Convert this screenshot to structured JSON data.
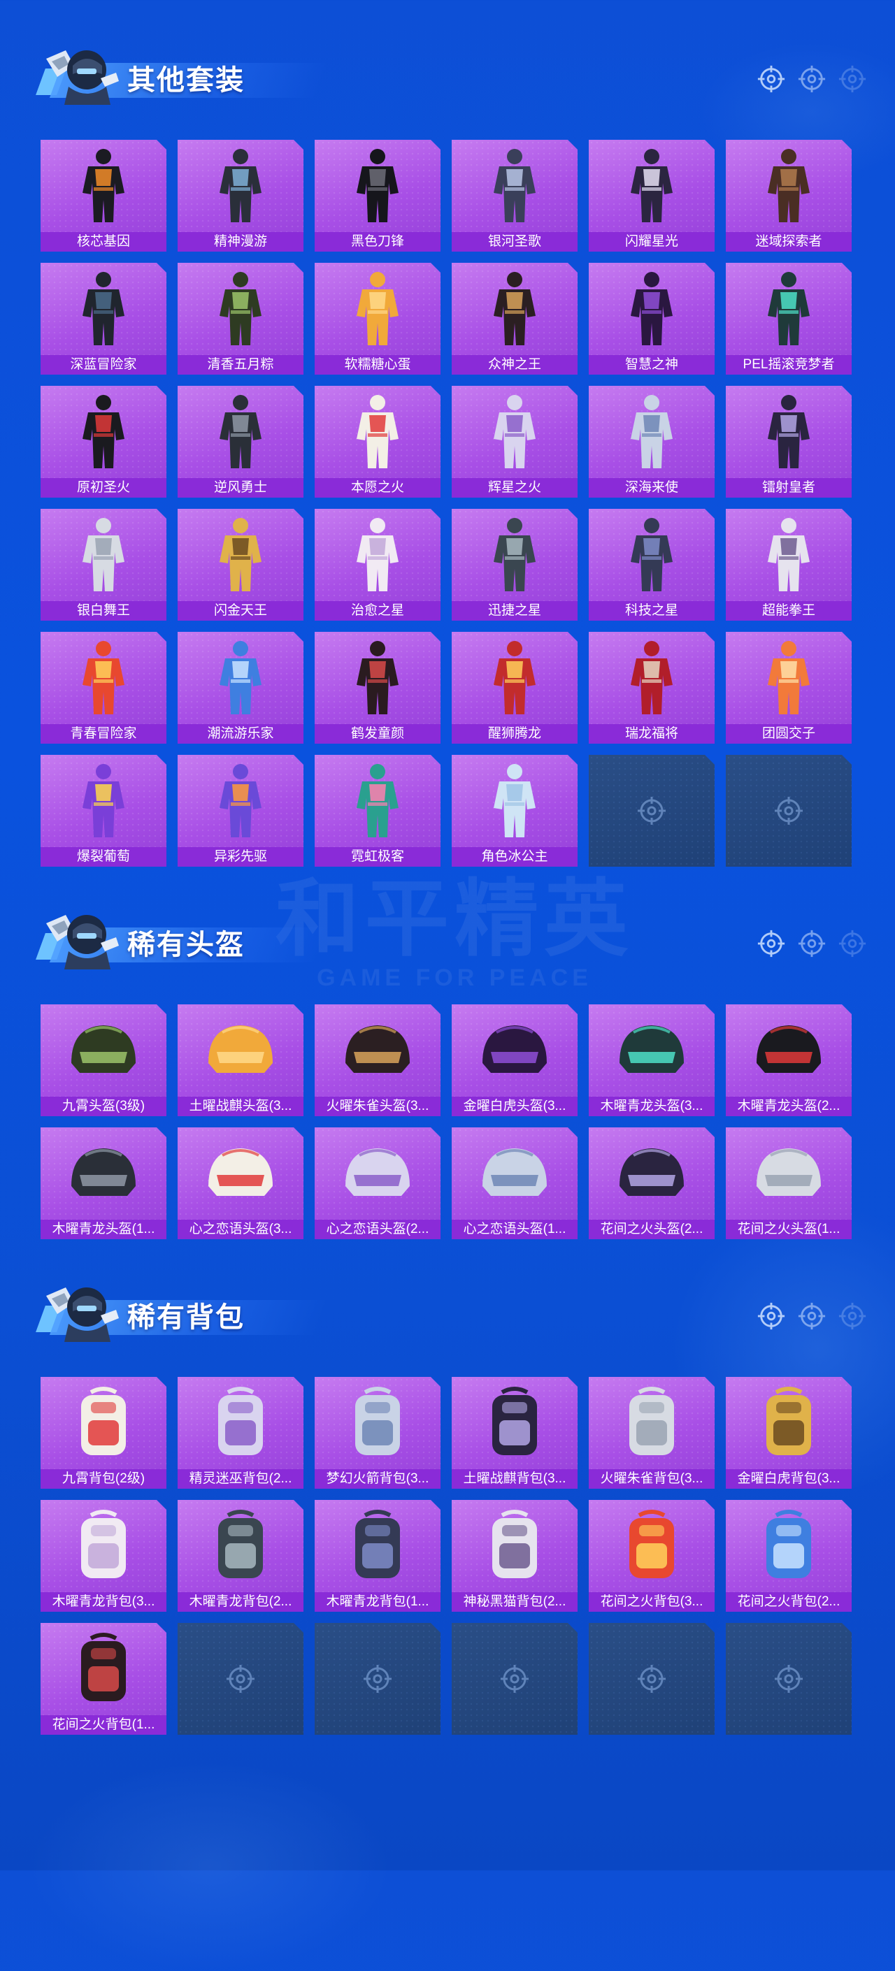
{
  "sections": [
    {
      "title": "其他套装",
      "kind": "suit",
      "items": [
        "核芯基因",
        "精神漫游",
        "黑色刀锋",
        "银河圣歌",
        "闪耀星光",
        "迷域探索者",
        "深蓝冒险家",
        "清香五月粽",
        "软糯糖心蛋",
        "众神之王",
        "智慧之神",
        "PEL摇滚竞梦者",
        "原初圣火",
        "逆风勇士",
        "本愿之火",
        "辉星之火",
        "深海来使",
        "镭射皇者",
        "银白舞王",
        "闪金天王",
        "治愈之星",
        "迅捷之星",
        "科技之星",
        "超能拳王",
        "青春冒险家",
        "潮流游乐家",
        "鹤发童颜",
        "醒狮腾龙",
        "瑞龙福将",
        "团圆交子",
        "爆裂葡萄",
        "异彩先驱",
        "霓虹极客",
        "角色冰公主"
      ],
      "empty_slots": 2
    },
    {
      "title": "稀有头盔",
      "kind": "helmet",
      "items": [
        "九霄头盔(3级)",
        "土曜战麒头盔(3...",
        "火曜朱雀头盔(3...",
        "金曜白虎头盔(3...",
        "木曜青龙头盔(3...",
        "木曜青龙头盔(2...",
        "木曜青龙头盔(1...",
        "心之恋语头盔(3...",
        "心之恋语头盔(2...",
        "心之恋语头盔(1...",
        "花间之火头盔(2...",
        "花间之火头盔(1..."
      ],
      "empty_slots": 0
    },
    {
      "title": "稀有背包",
      "kind": "backpack",
      "items": [
        "九霄背包(2级)",
        "精灵迷巫背包(2...",
        "梦幻火箭背包(3...",
        "土曜战麒背包(3...",
        "火曜朱雀背包(3...",
        "金曜白虎背包(3...",
        "木曜青龙背包(3...",
        "木曜青龙背包(2...",
        "木曜青龙背包(1...",
        "神秘黑猫背包(2...",
        "花间之火背包(3...",
        "花间之火背包(2...",
        "花间之火背包(1..."
      ],
      "empty_slots": 5
    }
  ],
  "watermark": {
    "big": "和平精英",
    "small": "GAME FOR PEACE"
  },
  "icons": {
    "header_avatar": "soldier-avatar-icon",
    "header_target": "crosshair-icon",
    "empty_slot": "crosshair-icon"
  },
  "colors": {
    "card": "#a84fe6",
    "label_bar": "#8a2bd8",
    "empty_card": "#244a80",
    "background": "#0b4fd6"
  }
}
